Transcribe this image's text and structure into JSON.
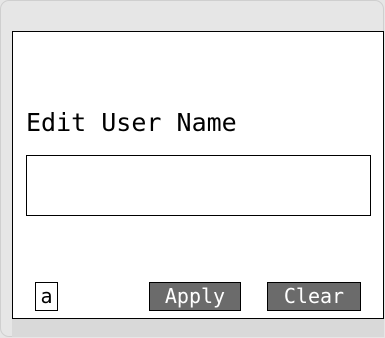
{
  "dialog": {
    "title": "Edit User Name",
    "input_value": "",
    "input_placeholder": "",
    "key_indicator": "a",
    "apply_label": "Apply",
    "clear_label": "Clear"
  },
  "colors": {
    "button_background": "#6b6b6b",
    "button_text": "#ffffff",
    "frame_background": "#e6e6e6",
    "window_background": "#ffffff"
  }
}
